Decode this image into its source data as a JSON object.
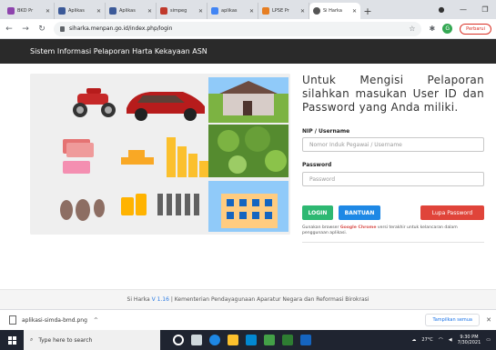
{
  "browser": {
    "tabs": [
      {
        "title": "BKD Pr",
        "color": "#8e44ad"
      },
      {
        "title": "Aplikas",
        "color": "#3b5998"
      },
      {
        "title": "Aplikas",
        "color": "#3b5998"
      },
      {
        "title": "simpeg",
        "color": "#c0392b"
      },
      {
        "title": "aplikas",
        "color": "#4285f4"
      },
      {
        "title": "LPSE Pr",
        "color": "#e67e22"
      },
      {
        "title": "Si Harka",
        "color": "#555555",
        "active": true
      }
    ],
    "new_tab": "+",
    "url": "siharka.menpan.go.id/index.php/login",
    "profile_initial": "G",
    "update_label": "Perbarui"
  },
  "site": {
    "header_title": "Sistem Informasi Pelaporan Harta Kekayaan ASN",
    "intro": "Untuk Mengisi Pelaporan silahkan masukan User ID dan Password yang Anda miliki.",
    "nip_label": "NIP / Username",
    "nip_placeholder": "Nomor Induk Pegawai / Username",
    "password_label": "Password",
    "password_placeholder": "Password",
    "login_button": "LOGIN",
    "help_button": "BANTUAN",
    "forgot_button": "Lupa Password",
    "note_prefix": "Gunakan browser",
    "note_browser": "Google Chrome",
    "note_suffix": "versi terakhir untuk kelancaran dalam penggunaan aplikasi.",
    "footer_app": "Si Harka",
    "footer_version": "V 1.16",
    "footer_org": "| Kementerian Pendayagunaan Aparatur Negara dan Reformasi Birokrasi"
  },
  "download_shelf": {
    "file": "aplikasi-simda-bmd.png",
    "show_all": "Tampilkan semua"
  },
  "taskbar": {
    "search_placeholder": "Type here to search",
    "weather": "27°C",
    "time": "9:30 PM",
    "date": "7/30/2021"
  },
  "colors": {
    "header_bg": "#2a2a2a",
    "login": "#2eb872",
    "help": "#1e88e5",
    "forgot": "#e0443a",
    "taskbar": "#1f2430"
  }
}
